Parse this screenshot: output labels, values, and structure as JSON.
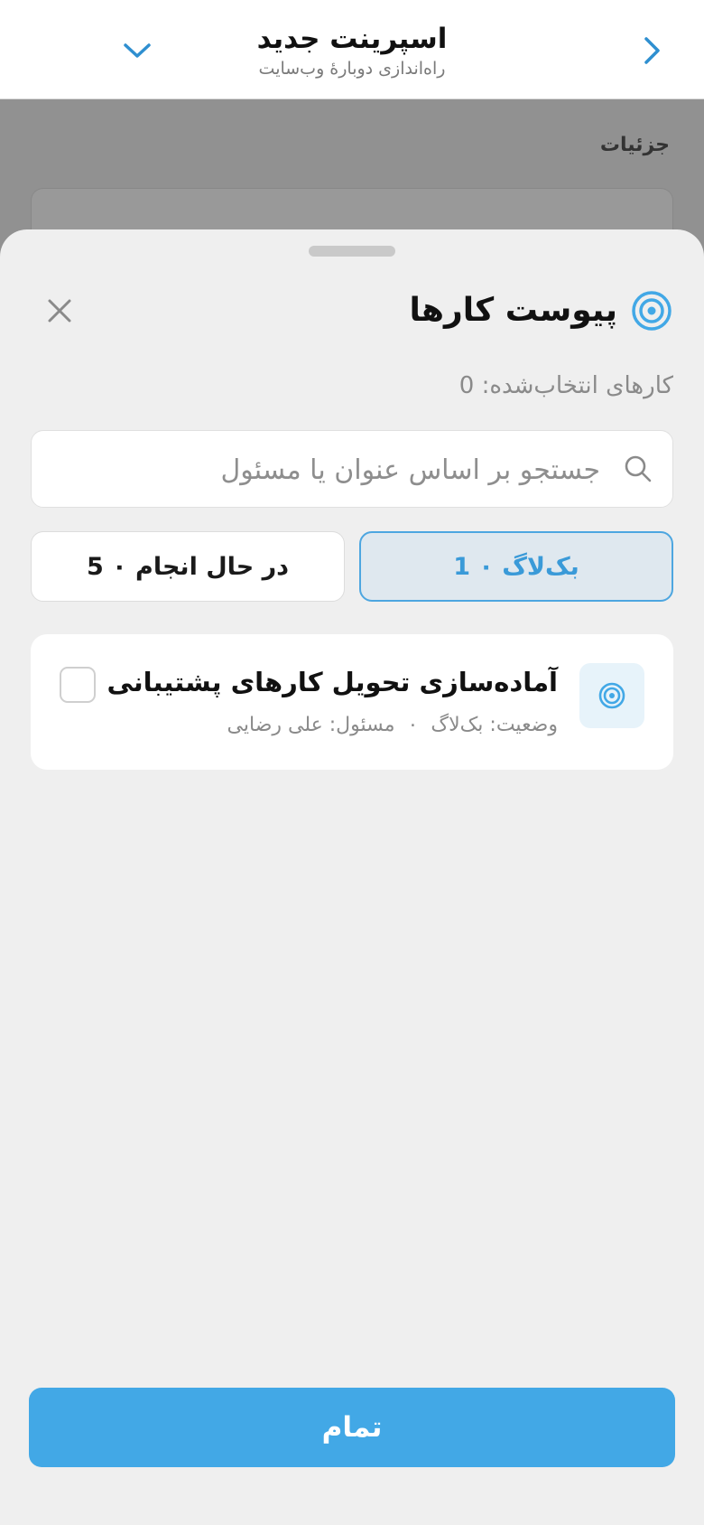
{
  "header": {
    "title": "اسپرینت جدید",
    "subtitle": "راه‌اندازی دوبارهٔ وب‌سایت",
    "back_icon": "chevron-right-icon",
    "expand_icon": "chevron-down-icon"
  },
  "background": {
    "section_label": "جزئیات"
  },
  "sheet": {
    "title": "پیوست کارها",
    "title_icon": "target-icon",
    "close_icon": "close-icon",
    "selected_count": "کارهای انتخاب‌شده: 0",
    "search": {
      "placeholder": "جستجو بر اساس عنوان یا مسئول",
      "value": ""
    },
    "tabs": [
      {
        "label": "بک‌لاگ ۰ 1",
        "active": true
      },
      {
        "label": "در حال انجام ۰ 5",
        "active": false
      }
    ],
    "tasks": [
      {
        "title": "آماده‌سازی تحویل کارهای پشتیبانی",
        "status": "وضعیت: بک‌لاگ",
        "separator": "۰",
        "assignee": "مسئول: علی رضایی",
        "checked": false
      }
    ],
    "done_label": "تمام"
  },
  "colors": {
    "accent": "#42a8e6",
    "accent_text": "#3a9ad8",
    "tab_active_bg": "#dfe8ef",
    "sheet_bg": "#efefef"
  }
}
